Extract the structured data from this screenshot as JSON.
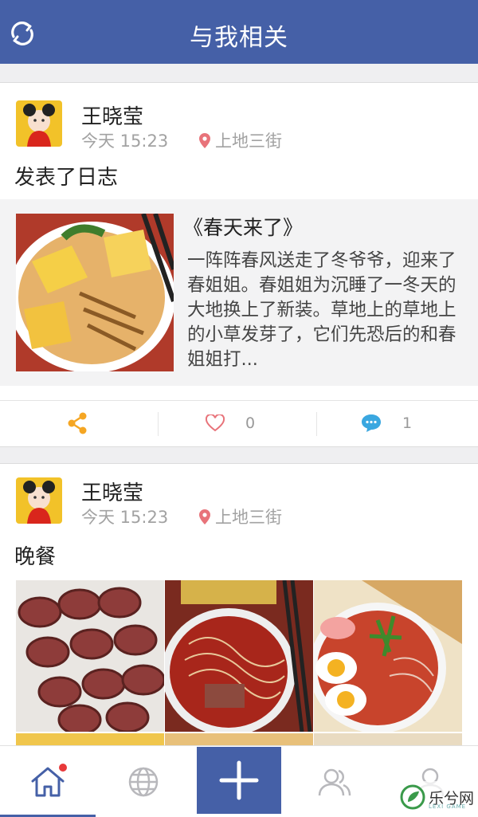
{
  "header": {
    "title": "与我相关",
    "refresh_icon": "refresh-icon"
  },
  "posts": [
    {
      "user_name": "王晓莹",
      "time": "今天 15:23",
      "location": "上地三街",
      "text": "发表了日志",
      "article": {
        "title": "《春天来了》",
        "body": "一阵阵春风送走了冬爷爷，迎来了春姐姐。春姐姐为沉睡了一冬天的大地换上了新装。草地上的草地上的小草发芽了，它们先恐后的和春姐姐打..."
      },
      "actions": {
        "share_icon": "share-icon",
        "like_icon": "heart-icon",
        "like_count": "0",
        "comment_icon": "comment-icon",
        "comment_count": "1"
      }
    },
    {
      "user_name": "王晓莹",
      "time": "今天 15:23",
      "location": "上地三街",
      "text": "晚餐",
      "photos": [
        "sausage-photo",
        "noodle-soup-photo",
        "egg-noodle-photo"
      ]
    }
  ],
  "tabbar": {
    "items": [
      {
        "icon": "home-icon",
        "active": true,
        "has_badge": true
      },
      {
        "icon": "globe-icon",
        "active": false
      },
      {
        "icon": "plus-icon",
        "active": false
      },
      {
        "icon": "friends-icon",
        "active": false
      },
      {
        "icon": "user-icon",
        "active": false
      }
    ]
  },
  "watermark": {
    "text": "乐兮网",
    "sub": "LEXI GAME"
  },
  "colors": {
    "brand": "#4560a7",
    "share": "#f5a623",
    "like": "#e8737a",
    "comment": "#3aa7e0",
    "badge": "#e8393a"
  }
}
